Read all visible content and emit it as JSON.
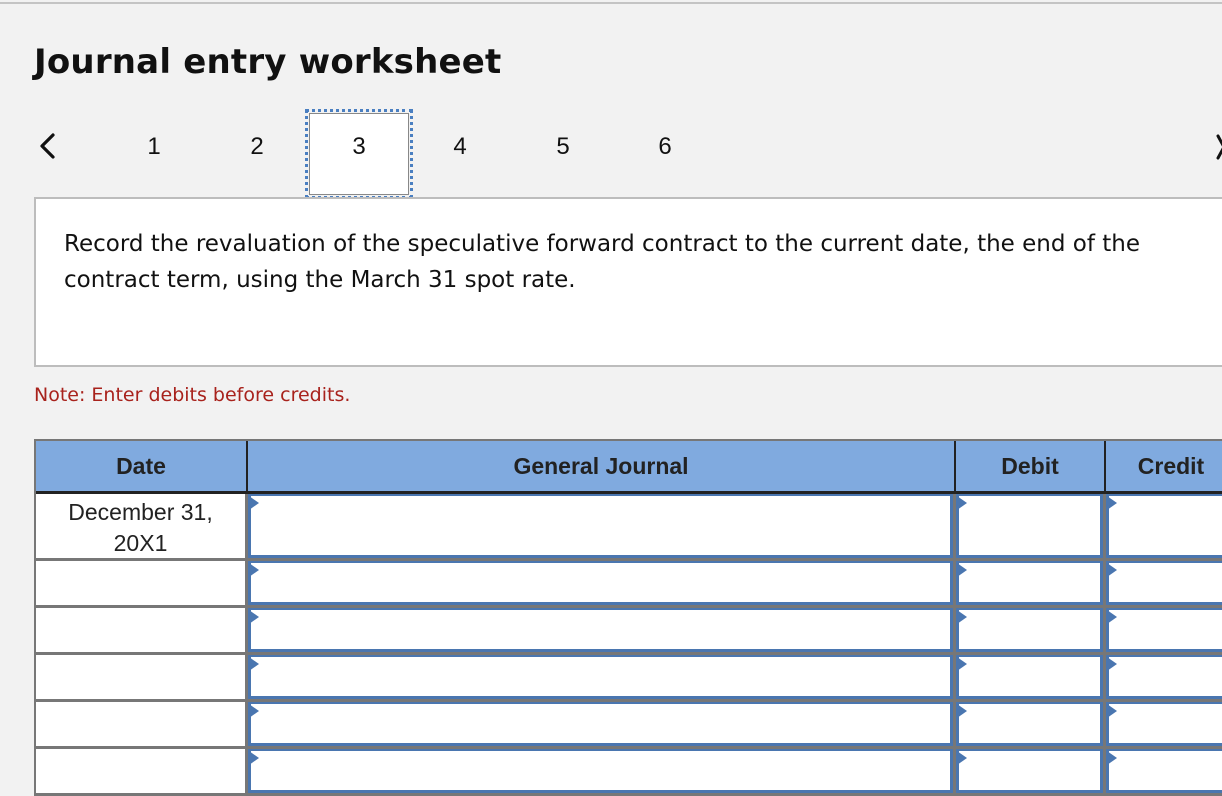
{
  "worksheet": {
    "title": "Journal entry worksheet",
    "nav": {
      "prev_icon": "chevron-left-icon",
      "next_icon": "chevron-right-icon",
      "tabs": [
        "1",
        "2",
        "3",
        "4",
        "5",
        "6"
      ],
      "active_tab": "3"
    },
    "prompt": "Record the revaluation of the speculative forward contract to the current date, the end of the contract term, using the March 31 spot rate.",
    "note": "Note: Enter debits before credits.",
    "accent_color": "#4a76b0",
    "header_color": "#80aadf",
    "note_color": "#a8221c"
  },
  "journal": {
    "columns": {
      "date": "Date",
      "account": "General Journal",
      "debit": "Debit",
      "credit": "Credit"
    },
    "rows": [
      {
        "date": "December 31, 20X1",
        "account": "",
        "debit": "",
        "credit": ""
      },
      {
        "date": "",
        "account": "",
        "debit": "",
        "credit": ""
      },
      {
        "date": "",
        "account": "",
        "debit": "",
        "credit": ""
      },
      {
        "date": "",
        "account": "",
        "debit": "",
        "credit": ""
      },
      {
        "date": "",
        "account": "",
        "debit": "",
        "credit": ""
      },
      {
        "date": "",
        "account": "",
        "debit": "",
        "credit": ""
      }
    ]
  }
}
